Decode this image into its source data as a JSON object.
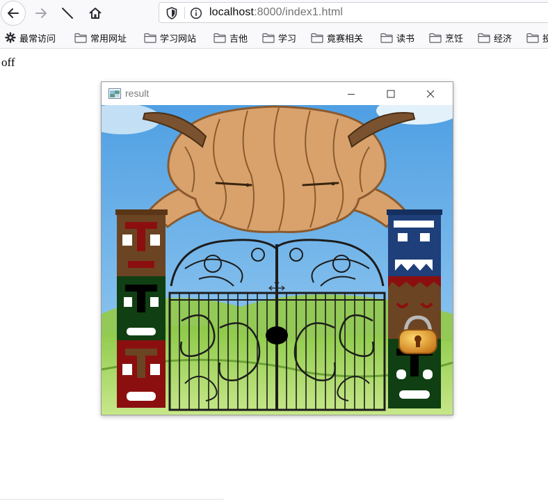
{
  "browser": {
    "url_host": "localhost",
    "url_rest": ":8000/index1.html"
  },
  "bookmarks": {
    "most_visited": "最常访问",
    "folders": [
      "常用网址",
      "学习网站",
      "吉他",
      "学习",
      "竟赛相关",
      "读书",
      "烹饪",
      "经济",
      "投"
    ]
  },
  "page": {
    "status_text": "off"
  },
  "window": {
    "title": "result"
  },
  "colors": {
    "sky": "#6fb6e8",
    "grass": "#a6d95a",
    "bull_skin": "#d9a26c",
    "bull_outline": "#8a5a2e",
    "horn": "#7a5230",
    "totem_brown": "#6b4423",
    "totem_red": "#8b0f0f",
    "totem_green": "#0f3f12",
    "totem_navy": "#1e3f7a",
    "lock_gold": "#e8a230"
  }
}
